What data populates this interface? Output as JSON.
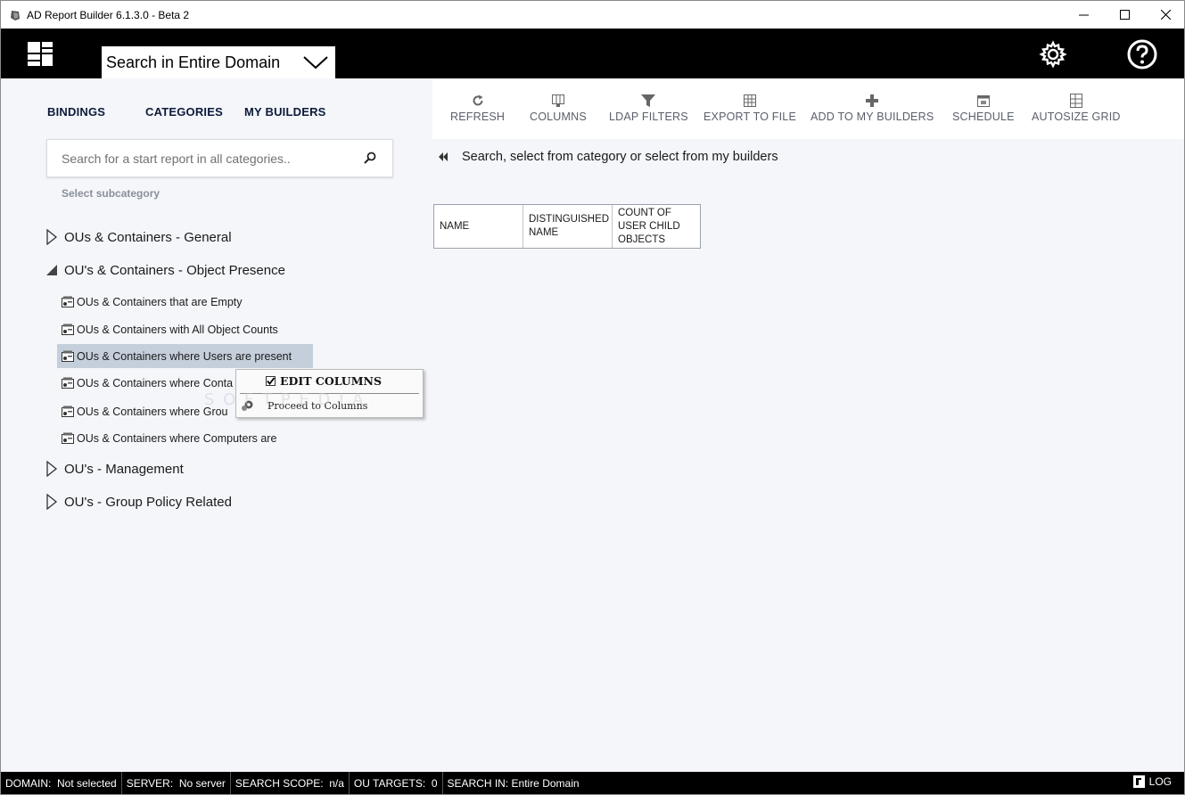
{
  "window": {
    "title": "AD Report Builder 6.1.3.0 - Beta 2",
    "controls": [
      "minimize",
      "maximize",
      "close"
    ]
  },
  "header": {
    "scope_label": "Search in Entire Domain",
    "icons": [
      "tiles-icon",
      "gear-icon",
      "help-icon"
    ]
  },
  "nav": {
    "tabs": [
      "BINDINGS",
      "CATEGORIES",
      "MY BUILDERS"
    ]
  },
  "search": {
    "placeholder": "Search for a start report in all categories..",
    "subcategory_label": "Select subcategory"
  },
  "categories": [
    {
      "label": "OUs & Containers - General",
      "expanded": false
    },
    {
      "label": "OU's & Containers - Object Presence",
      "expanded": true
    },
    {
      "label": "OU's - Management",
      "expanded": false
    },
    {
      "label": "OU's - Group Policy Related",
      "expanded": false
    }
  ],
  "subitems": [
    "OUs & Containers that are Empty",
    "OUs & Containers with All Object Counts",
    "OUs & Containers where Users are present",
    "OUs & Containers where Conta",
    "OUs & Containers where Grou",
    "OUs & Containers where Computers are"
  ],
  "selected_subitem": "OUs & Containers where Users are present",
  "context_menu": {
    "edit_columns": "EDIT COLUMNS",
    "proceed": "Proceed to Columns"
  },
  "toolbar": {
    "buttons": [
      "REFRESH",
      "COLUMNS",
      "LDAP FILTERS",
      "EXPORT TO FILE",
      "ADD TO MY BUILDERS",
      "SCHEDULE",
      "AUTOSIZE GRID"
    ]
  },
  "hint": "Search, select from category or select from my builders",
  "grid": {
    "columns": [
      "NAME",
      "DISTINGUISHED NAME",
      "COUNT OF USER CHILD OBJECTS"
    ]
  },
  "status": {
    "domain": "DOMAIN:  Not selected",
    "server": "SERVER:  No server",
    "scope": "SEARCH SCOPE:  n/a",
    "ou_targets": "OU TARGETS:  0",
    "search_in": "SEARCH IN: Entire Domain",
    "log": "LOG"
  },
  "colors": {
    "header_bg": "#000000",
    "panel_bg": "#f4f6fa",
    "selection": "#c5cfdc",
    "nav_text": "#0d1a3a"
  }
}
